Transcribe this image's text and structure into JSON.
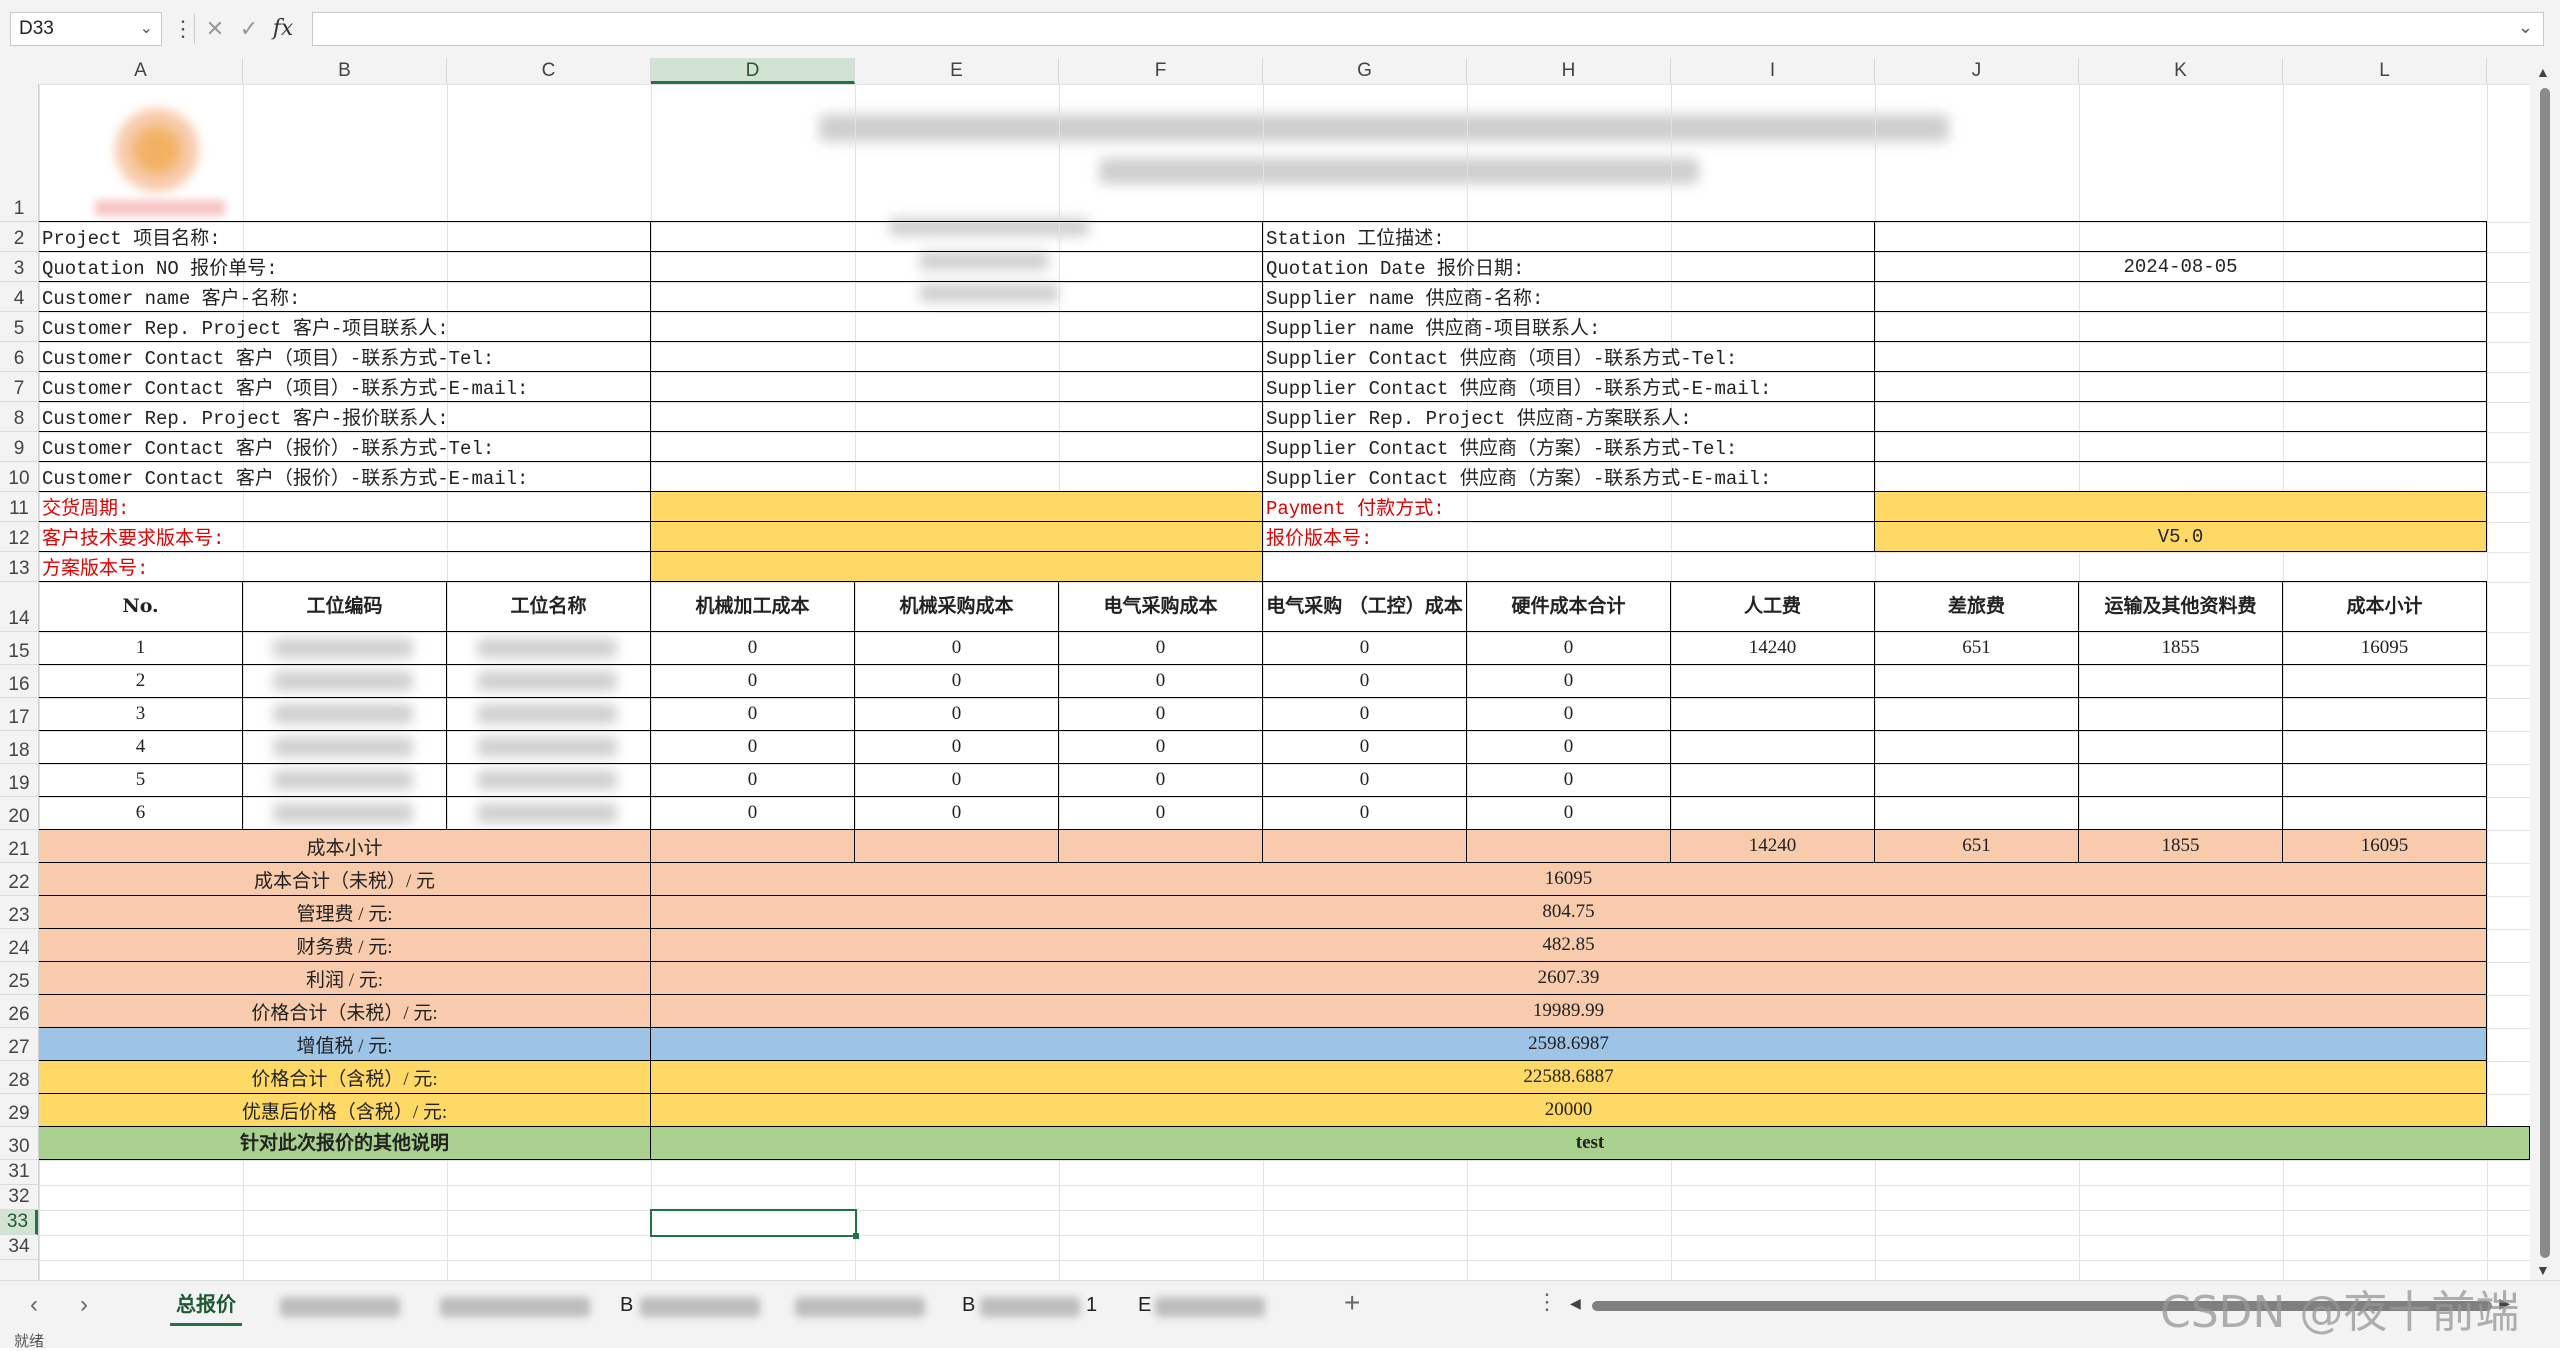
{
  "formula_bar": {
    "name_box": "D33",
    "fx_label": "fx",
    "formula": ""
  },
  "columns": [
    "A",
    "B",
    "C",
    "D",
    "E",
    "F",
    "G",
    "H",
    "I",
    "J",
    "K",
    "L"
  ],
  "rows": [
    "1",
    "2",
    "3",
    "4",
    "5",
    "6",
    "7",
    "8",
    "9",
    "10",
    "11",
    "12",
    "13",
    "14",
    "15",
    "16",
    "17",
    "18",
    "19",
    "20",
    "21",
    "22",
    "23",
    "24",
    "25",
    "26",
    "27",
    "28",
    "29",
    "30",
    "31",
    "32",
    "33",
    "34"
  ],
  "info": {
    "left_labels": [
      "Project 项目名称:",
      "Quotation NO 报价单号:",
      "Customer name 客户-名称:",
      "Customer Rep. Project 客户-项目联系人:",
      "Customer Contact 客户（项目）-联系方式-Tel:",
      "Customer Contact 客户（项目）-联系方式-E-mail:",
      "Customer Rep. Project 客户-报价联系人:",
      "Customer Contact 客户（报价）-联系方式-Tel:",
      "Customer Contact 客户（报价）-联系方式-E-mail:"
    ],
    "right_labels": [
      "Station 工位描述:",
      "Quotation Date 报价日期:",
      "Supplier name 供应商-名称:",
      "Supplier name 供应商-项目联系人:",
      "Supplier Contact 供应商（项目）-联系方式-Tel:",
      "Supplier Contact 供应商（项目）-联系方式-E-mail:",
      "Supplier Rep. Project 供应商-方案联系人:",
      "Supplier Contact 供应商（方案）-联系方式-Tel:",
      "Supplier Contact 供应商（方案）-联系方式-E-mail:"
    ],
    "quotation_date": "2024-08-05",
    "delivery_label": "交货周期:",
    "payment_label": "Payment 付款方式:",
    "customer_version_label": "客户技术要求版本号:",
    "quote_version_label": "报价版本号:",
    "quote_version_value": "V5.0",
    "plan_version_label": "方案版本号:"
  },
  "table": {
    "headers": [
      "No.",
      "工位编码",
      "工位名称",
      "机械加工成本",
      "机械采购成本",
      "电气采购成本",
      "电气采购\n（工控）成本",
      "硬件成本合计",
      "人工费",
      "差旅费",
      "运输及其他资料费",
      "成本小计"
    ],
    "rows": [
      {
        "no": "1",
        "mech": "0",
        "mbuy": "0",
        "ebuy": "0",
        "ectrl": "0",
        "hw": "0",
        "labor": "14240",
        "travel": "651",
        "trans": "1855",
        "sub": "16095"
      },
      {
        "no": "2",
        "mech": "0",
        "mbuy": "0",
        "ebuy": "0",
        "ectrl": "0",
        "hw": "0",
        "labor": "",
        "travel": "",
        "trans": "",
        "sub": ""
      },
      {
        "no": "3",
        "mech": "0",
        "mbuy": "0",
        "ebuy": "0",
        "ectrl": "0",
        "hw": "0",
        "labor": "",
        "travel": "",
        "trans": "",
        "sub": ""
      },
      {
        "no": "4",
        "mech": "0",
        "mbuy": "0",
        "ebuy": "0",
        "ectrl": "0",
        "hw": "0",
        "labor": "",
        "travel": "",
        "trans": "",
        "sub": ""
      },
      {
        "no": "5",
        "mech": "0",
        "mbuy": "0",
        "ebuy": "0",
        "ectrl": "0",
        "hw": "0",
        "labor": "",
        "travel": "",
        "trans": "",
        "sub": ""
      },
      {
        "no": "6",
        "mech": "0",
        "mbuy": "0",
        "ebuy": "0",
        "ectrl": "0",
        "hw": "0",
        "labor": "",
        "travel": "",
        "trans": "",
        "sub": ""
      }
    ],
    "row2_name_suffix": "位",
    "subtotal": {
      "label": "成本小计",
      "labor": "14240",
      "travel": "651",
      "trans": "1855",
      "sub": "16095"
    }
  },
  "summary": [
    {
      "label": "成本合计（未税）/ 元",
      "value": "16095",
      "color": "peach"
    },
    {
      "label": "管理费 / 元:",
      "value": "804.75",
      "color": "peach"
    },
    {
      "label": "财务费 / 元:",
      "value": "482.85",
      "color": "peach"
    },
    {
      "label": "利润 / 元:",
      "value": "2607.39",
      "color": "peach"
    },
    {
      "label": "价格合计（未税）/ 元:",
      "value": "19989.99",
      "color": "peach"
    },
    {
      "label": "增值税 / 元:",
      "value": "2598.6987",
      "color": "blue"
    },
    {
      "label": "价格合计（含税）/ 元:",
      "value": "22588.6887",
      "color": "yellow"
    },
    {
      "label": "优惠后价格（含税）/ 元:",
      "value": "20000",
      "color": "yellow"
    }
  ],
  "notes": {
    "label": "针对此次报价的其他说明",
    "value": "test"
  },
  "sheets": {
    "active": "总报价",
    "partial_b1": "B",
    "partial_b2": "B",
    "partial_b3": "1",
    "partial_b4": "E"
  },
  "status": {
    "ready": "就绪"
  },
  "watermark": "CSDN @夜十前端",
  "colors": {
    "yellow": "#ffd966",
    "peach": "#f8cbad",
    "blue": "#9dc3e6",
    "green": "#a9d08e",
    "accent": "#217346"
  }
}
